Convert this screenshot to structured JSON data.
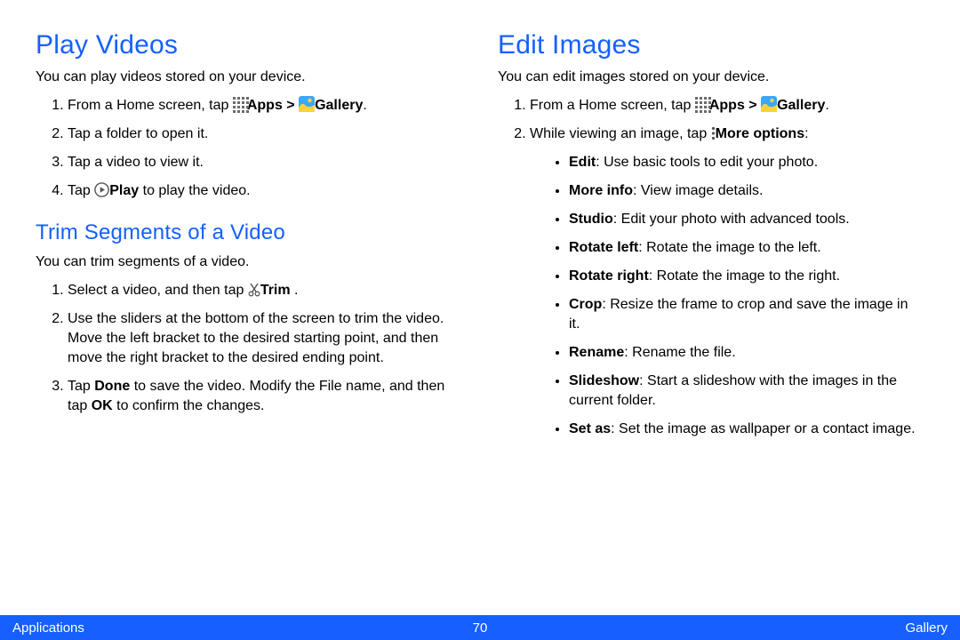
{
  "left": {
    "h1": "Play Videos",
    "intro": "You can play videos stored on your device.",
    "step1_a": "From a Home screen, tap ",
    "step1_apps": "Apps > ",
    "step1_gallery": "Gallery",
    "step1_dot": ".",
    "step2": "Tap a folder to open it.",
    "step3": "Tap a video to view it.",
    "step4_a": "Tap ",
    "step4_play": "Play",
    "step4_b": "  to play the video.",
    "h2": "Trim Segments of a Video",
    "intro2": "You can trim segments of a video.",
    "t1_a": "Select a video, and then tap ",
    "t1_trim": "Trim",
    "t1_b": " .",
    "t2": "Use the sliders at the bottom of the screen to trim the video. Move the left bracket to the desired starting point, and then move the right bracket to the desired ending point.",
    "t3_a": "Tap ",
    "t3_done": "Done",
    "t3_b": " to save the video. Modify the File name, and then tap ",
    "t3_ok": "OK",
    "t3_c": " to confirm the changes."
  },
  "right": {
    "h1": "Edit Images",
    "intro": "You can edit images stored on your device.",
    "step1_a": "From a Home screen, tap ",
    "step1_apps": "Apps > ",
    "step1_gallery": "Gallery",
    "step1_dot": ".",
    "step2_a": "While viewing an image, tap ",
    "step2_more": "More options",
    "step2_b": ":",
    "opts": {
      "edit_k": "Edit",
      "edit_v": ": Use basic tools to edit your photo.",
      "info_k": "More info",
      "info_v": ": View image details.",
      "studio_k": "Studio",
      "studio_v": ": Edit your photo with advanced tools.",
      "rl_k": "Rotate left",
      "rl_v": ": Rotate the image to the left.",
      "rr_k": "Rotate right",
      "rr_v": ": Rotate the image to the right.",
      "crop_k": "Crop",
      "crop_v": ": Resize the frame to crop and save the image in it.",
      "ren_k": "Rename",
      "ren_v": ": Rename the file.",
      "ss_k": "Slideshow",
      "ss_v": ": Start a slideshow with the images in the current folder.",
      "sa_k": "Set as",
      "sa_v": ": Set the image as wallpaper or a contact image."
    }
  },
  "footer": {
    "left": "Applications",
    "page": "70",
    "right": "Gallery"
  }
}
